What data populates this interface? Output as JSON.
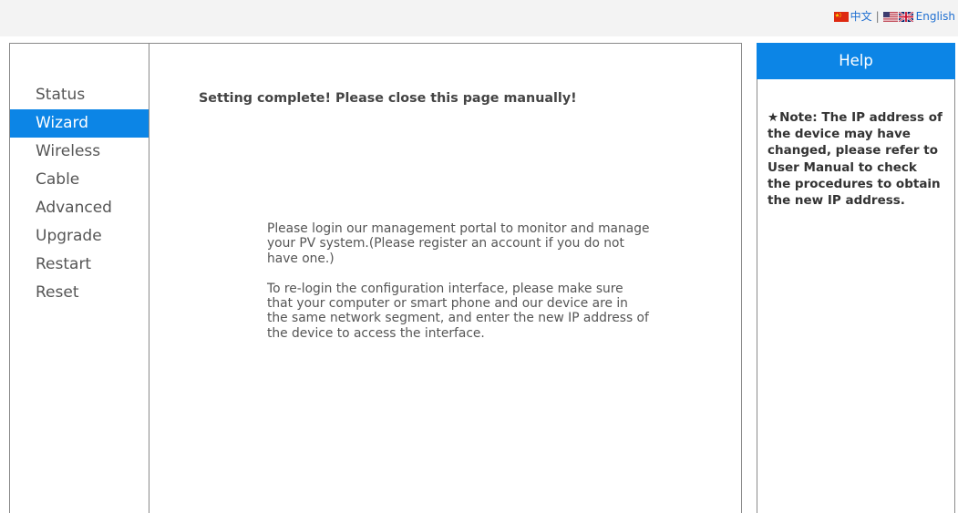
{
  "language_switch": {
    "chinese_label": "中文",
    "separator": "|",
    "english_label": "English",
    "icons": [
      "china-flag-icon",
      "usa-flag-icon",
      "uk-flag-icon"
    ]
  },
  "sidebar": {
    "items": [
      {
        "label": "Status",
        "active": false
      },
      {
        "label": "Wizard",
        "active": true
      },
      {
        "label": "Wireless",
        "active": false
      },
      {
        "label": "Cable",
        "active": false
      },
      {
        "label": "Advanced",
        "active": false
      },
      {
        "label": "Upgrade",
        "active": false
      },
      {
        "label": "Restart",
        "active": false
      },
      {
        "label": "Reset",
        "active": false
      }
    ]
  },
  "main": {
    "heading": "Setting complete! Please close this page manually!",
    "paragraphs": [
      {
        "lines": [
          "Please login our management portal to monitor and manage",
          "your PV system.(Please register an account if you do not",
          "have one.)"
        ]
      },
      {
        "lines": [
          "To re-login the configuration interface, please make sure",
          "that your computer or smart phone and our device are in",
          "the same network segment, and enter the new IP address of",
          "the device to access the interface."
        ]
      }
    ]
  },
  "help": {
    "title": "Help",
    "note_icon": "star-icon",
    "note_lines": [
      "Note: The IP address of",
      "the device may have",
      "changed, please refer to",
      "User Manual to check",
      "the procedures to obtain",
      "the new IP address."
    ]
  },
  "colors": {
    "accent": "#0c85e6",
    "link": "#1f6fd1"
  }
}
